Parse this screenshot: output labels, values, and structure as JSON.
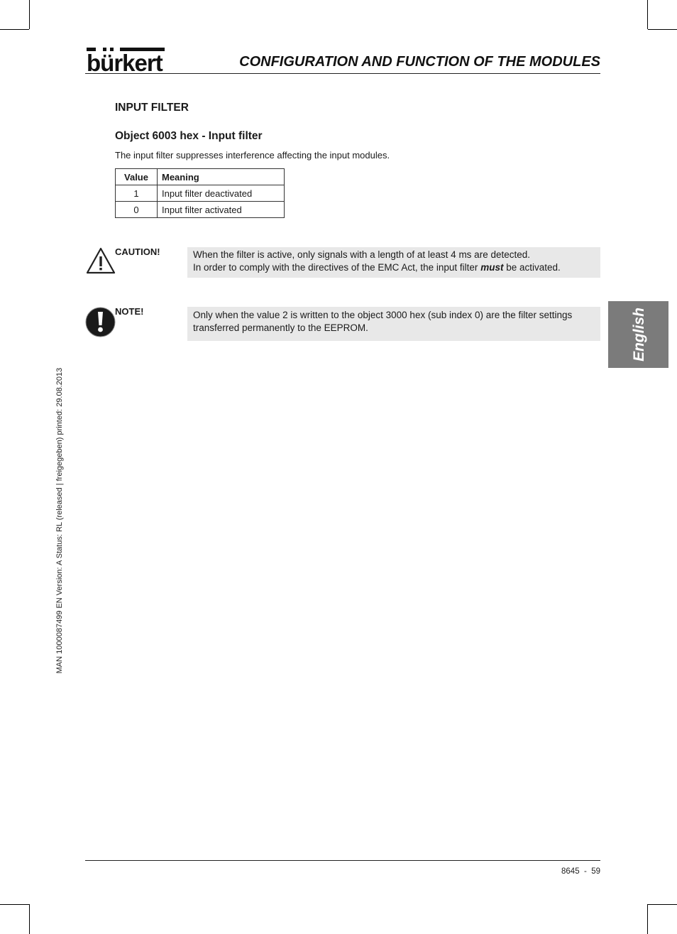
{
  "header": {
    "logo": "bürkert",
    "title": "CONFIGURATION AND FUNCTION OF THE MODULES"
  },
  "section": {
    "heading": "INPUT FILTER",
    "subheading": "Object 6003 hex - Input filter",
    "intro": "The input filter suppresses interference affecting the input modules."
  },
  "table": {
    "headers": [
      "Value",
      "Meaning"
    ],
    "rows": [
      {
        "value": "1",
        "meaning": "Input filter deactivated"
      },
      {
        "value": "0",
        "meaning": "Input filter activated"
      }
    ]
  },
  "caution": {
    "icon": "warning-triangle-icon",
    "label": "CAUTION!",
    "line1": "When the filter is active, only signals with a length of at least 4 ms are detected.",
    "line2_pre": "In order to comply with the directives of the EMC Act, the input filter ",
    "line2_emph": "must",
    "line2_post": " be activated."
  },
  "note": {
    "icon": "exclamation-circle-icon",
    "label": "NOTE!",
    "text": "Only when the value 2 is written to the object 3000 hex (sub index 0) are the filter settings transferred permanently to the EEPROM."
  },
  "language_tab": "English",
  "side_meta": "MAN  1000087499  EN  Version: A  Status: RL (released | freigegeben)  printed: 29.08.2013",
  "footer": {
    "page": "8645  -  59"
  }
}
